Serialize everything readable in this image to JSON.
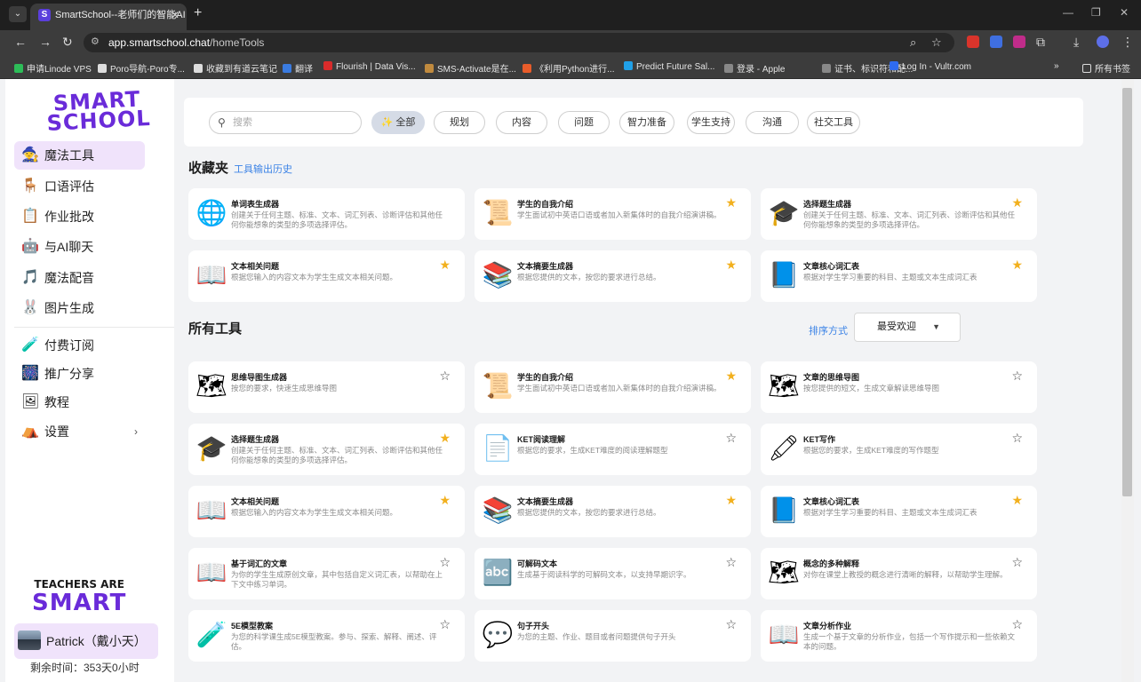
{
  "browser": {
    "tab_title": "SmartSchool--老师们的智能AI",
    "tab_favicon": "S",
    "url_host": "app.smartschool.chat",
    "url_path": "/homeTools",
    "bookmarks": [
      {
        "label": "申请Linode VPS",
        "color": "#2dbd58"
      },
      {
        "label": "Poro导航-Poro专...",
        "color": "#dddddd"
      },
      {
        "label": "收藏到有道云笔记",
        "color": "#dddddd"
      },
      {
        "label": "翻译",
        "color": "#3a7be0"
      },
      {
        "label": "Flourish | Data Vis...",
        "color": "#d92b2b"
      },
      {
        "label": "SMS-Activate是在...",
        "color": "#c08a3e"
      },
      {
        "label": "《利用Python进行...",
        "color": "#e85c2a"
      },
      {
        "label": "Predict Future Sal...",
        "color": "#20a0e8"
      },
      {
        "label": "登录 - Apple",
        "color": "#888888"
      },
      {
        "label": "证书、标识符和配...",
        "color": "#888888"
      },
      {
        "label": "Log In - Vultr.com",
        "color": "#2f6bf0"
      }
    ],
    "all_bookmarks": "所有书签"
  },
  "sidebar": {
    "logo_line1": "SMART",
    "logo_line2": "SCHOOL",
    "items": [
      {
        "label": "魔法工具",
        "icon": "🧙",
        "name": "magic-tools"
      },
      {
        "label": "口语评估",
        "icon": "🪑",
        "name": "speaking-assessment"
      },
      {
        "label": "作业批改",
        "icon": "📋",
        "name": "homework-grading"
      },
      {
        "label": "与AI聊天",
        "icon": "🤖",
        "name": "ai-chat"
      },
      {
        "label": "魔法配音",
        "icon": "🎵",
        "name": "magic-dubbing"
      },
      {
        "label": "图片生成",
        "icon": "🐰",
        "name": "image-generation"
      }
    ],
    "items2": [
      {
        "label": "付费订阅",
        "icon": "🧪",
        "name": "subscription"
      },
      {
        "label": "推广分享",
        "icon": "🎆",
        "name": "referral"
      },
      {
        "label": "教程",
        "icon": "🖼",
        "name": "tutorial"
      },
      {
        "label": "设置",
        "icon": "⛺",
        "name": "settings"
      }
    ],
    "teachers_line1": "TEACHERS ARE",
    "teachers_line2": "SMART",
    "user_name": "Patrick（戴小天）",
    "remaining": "剩余时间：353天0小时"
  },
  "filters": {
    "search_placeholder": "搜索",
    "chips": [
      "✨ 全部",
      "规划",
      "内容",
      "问题",
      "智力准备",
      "学生支持",
      "沟通",
      "社交工具"
    ]
  },
  "favorites": {
    "title": "收藏夹",
    "history_link": "工具输出历史",
    "cards": [
      {
        "title": "单词表生成器",
        "desc": "创建关于任何主题、标准、文本、词汇列表、诊断评估和其他任何你能想象的类型的多项选择评估。",
        "icon": "🌐",
        "star": "",
        "starred": false
      },
      {
        "title": "学生的自我介绍",
        "desc": "学生面试初中英语口语或者加入新集体时的自我介绍演讲稿。",
        "icon": "📜",
        "star": "★",
        "starred": true
      },
      {
        "title": "选择题生成器",
        "desc": "创建关于任何主题、标准、文本、词汇列表、诊断评估和其他任何你能想象的类型的多项选择评估。",
        "icon": "🎓",
        "star": "★",
        "starred": true
      },
      {
        "title": "文本相关问题",
        "desc": "根据您输入的内容文本为学生生成文本相关问题。",
        "icon": "📖",
        "star": "★",
        "starred": true
      },
      {
        "title": "文本摘要生成器",
        "desc": "根据您提供的文本，按您的要求进行总结。",
        "icon": "📚",
        "star": "★",
        "starred": true
      },
      {
        "title": "文章核心词汇表",
        "desc": "根据对学生学习重要的科目、主题或文本生成词汇表",
        "icon": "📘",
        "star": "★",
        "starred": true
      }
    ]
  },
  "all_tools": {
    "title": "所有工具",
    "sort_label": "排序方式",
    "sort_value": "最受欢迎",
    "cards": [
      {
        "title": "思维导图生成器",
        "desc": "按您的要求，快速生成思维导图",
        "icon": "🗺",
        "star": "☆",
        "starred": false
      },
      {
        "title": "学生的自我介绍",
        "desc": "学生面试初中英语口语或者加入新集体时的自我介绍演讲稿。",
        "icon": "📜",
        "star": "★",
        "starred": true
      },
      {
        "title": "文章的思维导图",
        "desc": "按您提供的短文，生成文章解读思维导图",
        "icon": "🗺",
        "star": "☆",
        "starred": false
      },
      {
        "title": "选择题生成器",
        "desc": "创建关于任何主题、标准、文本、词汇列表、诊断评估和其他任何你能想象的类型的多项选择评估。",
        "icon": "🎓",
        "star": "★",
        "starred": true
      },
      {
        "title": "KET阅读理解",
        "desc": "根据您的要求，生成KET难度的阅读理解题型",
        "icon": "📄",
        "star": "☆",
        "starred": false
      },
      {
        "title": "KET写作",
        "desc": "根据您的要求，生成KET难度的写作题型",
        "icon": "🖍",
        "star": "☆",
        "starred": false
      },
      {
        "title": "文本相关问题",
        "desc": "根据您输入的内容文本为学生生成文本相关问题。",
        "icon": "📖",
        "star": "★",
        "starred": true
      },
      {
        "title": "文本摘要生成器",
        "desc": "根据您提供的文本，按您的要求进行总结。",
        "icon": "📚",
        "star": "★",
        "starred": true
      },
      {
        "title": "文章核心词汇表",
        "desc": "根据对学生学习重要的科目、主题或文本生成词汇表",
        "icon": "📘",
        "star": "★",
        "starred": true
      },
      {
        "title": "基于词汇的文章",
        "desc": "为你的学生生成原创文章，其中包括自定义词汇表，以帮助在上下文中练习单词。",
        "icon": "📖",
        "star": "☆",
        "starred": false
      },
      {
        "title": "可解码文本",
        "desc": "生成基于阅读科学的可解码文本，以支持早期识字。",
        "icon": "🔤",
        "star": "☆",
        "starred": false
      },
      {
        "title": "概念的多种解释",
        "desc": "对你在课堂上教授的概念进行清晰的解释，以帮助学生理解。",
        "icon": "🗺",
        "star": "☆",
        "starred": false
      },
      {
        "title": "5E模型教案",
        "desc": "为您的科学课生成5E模型教案。参与、探索、解释、阐述、评估。",
        "icon": "🧪",
        "star": "☆",
        "starred": false
      },
      {
        "title": "句子开头",
        "desc": "为您的主题、作业、题目或者问题提供句子开头",
        "icon": "💬",
        "star": "☆",
        "starred": false
      },
      {
        "title": "文章分析作业",
        "desc": "生成一个基于文章的分析作业，包括一个写作提示和一些依赖文本的问题。",
        "icon": "📖",
        "star": "☆",
        "starred": false
      }
    ]
  },
  "colors": {
    "accent": "#6a2bd9",
    "star": "#f2b01e",
    "link": "#3c83e6",
    "active_nav": "#f0e3fb"
  }
}
